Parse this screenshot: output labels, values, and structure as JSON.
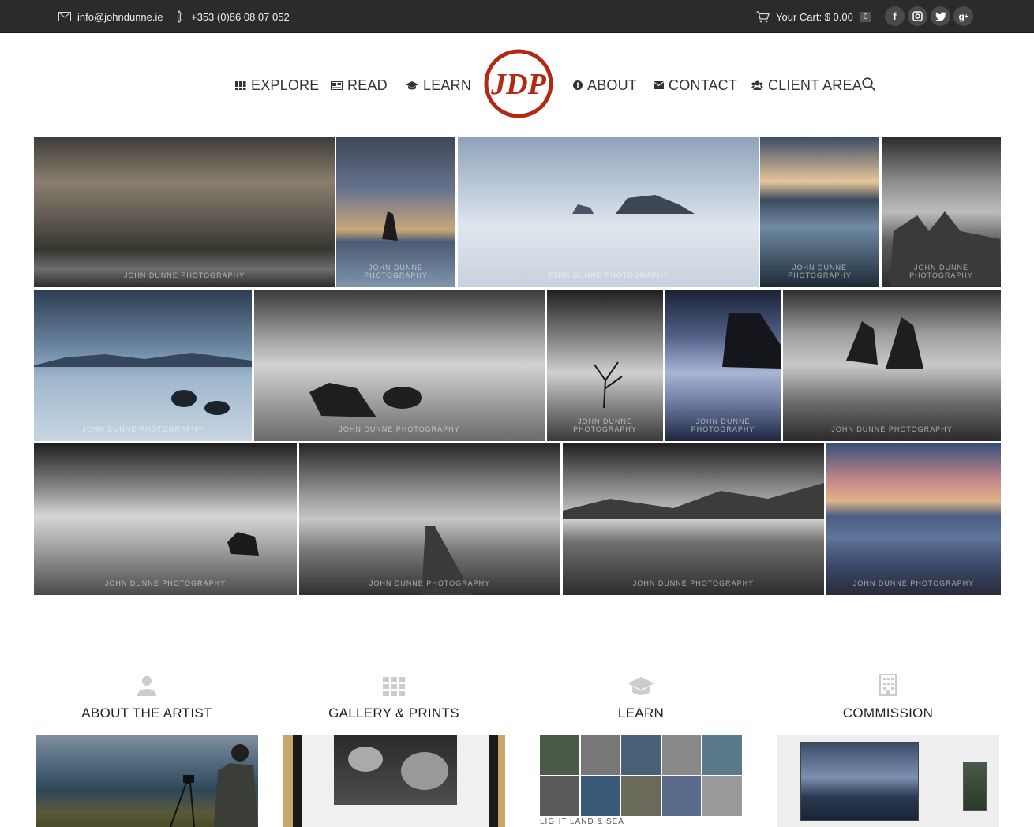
{
  "topbar": {
    "email": "info@johndunne.ie",
    "phone": "+353 (0)86 08 07 052",
    "cart_label": "Your Cart: $ 0.00",
    "cart_count": "0",
    "socials": [
      "f",
      "ig",
      "tw",
      "g+"
    ]
  },
  "nav": {
    "left": [
      "EXPLORE",
      "READ",
      "LEARN"
    ],
    "right": [
      "ABOUT",
      "CONTACT",
      "CLIENT AREA"
    ],
    "logo_text": "JDP"
  },
  "gallery": {
    "watermark": "JOHN DUNNE PHOTOGRAPHY"
  },
  "sections": [
    {
      "title": "ABOUT THE ARTIST",
      "icon": "user-icon"
    },
    {
      "title": "GALLERY & PRINTS",
      "icon": "grid-icon"
    },
    {
      "title": "LEARN",
      "icon": "graduation-cap-icon"
    },
    {
      "title": "COMMISSION",
      "icon": "building-icon"
    }
  ],
  "learn_caption": "LIGHT LAND & SEA",
  "colors": {
    "topbar": "#2b2b2b",
    "logo": "#b22a14",
    "text": "#333333"
  }
}
